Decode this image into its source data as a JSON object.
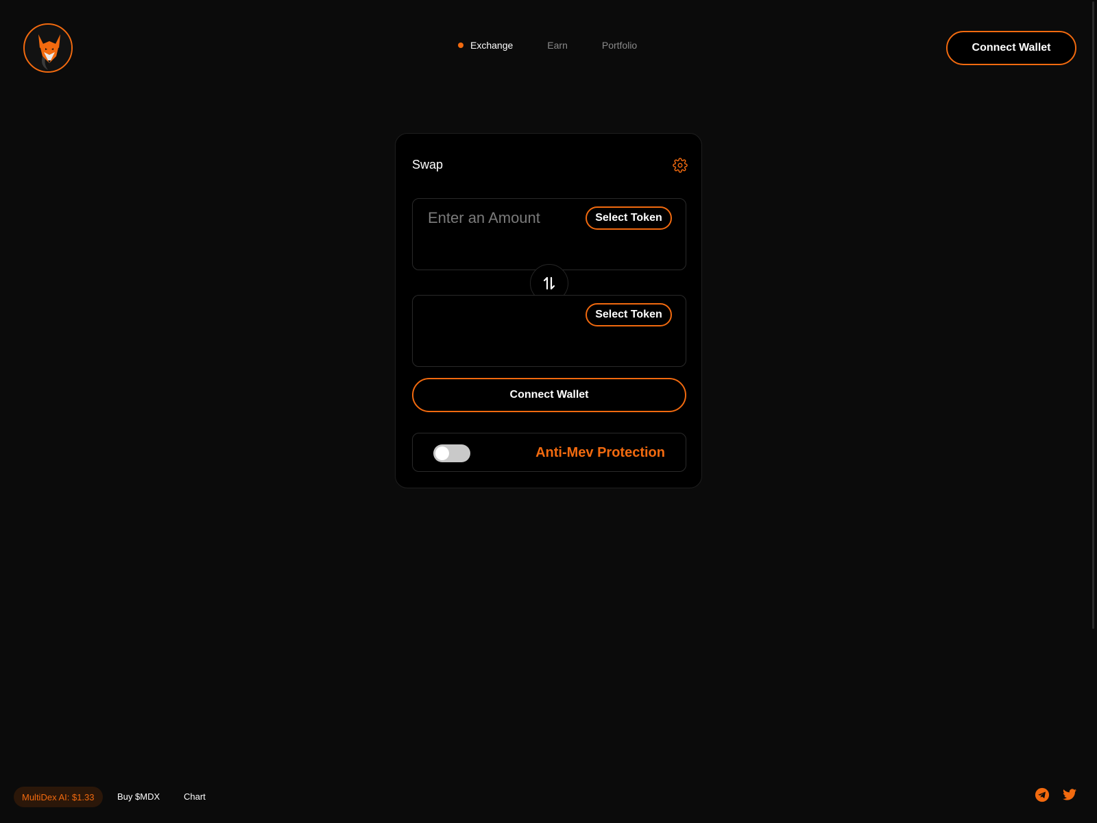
{
  "header": {
    "nav": [
      {
        "label": "Exchange",
        "active": true
      },
      {
        "label": "Earn",
        "active": false
      },
      {
        "label": "Portfolio",
        "active": false
      }
    ],
    "connect_label": "Connect Wallet"
  },
  "swap": {
    "title": "Swap",
    "from": {
      "amount_placeholder": "Enter an Amount",
      "select_label": "Select Token"
    },
    "to": {
      "select_label": "Select Token"
    },
    "connect_label": "Connect Wallet",
    "anti_mev": {
      "label": "Anti-Mev Protection",
      "enabled": false
    }
  },
  "footer": {
    "price_label": "MultiDex AI: $1.33",
    "buy_label": "Buy $MDX",
    "chart_label": "Chart"
  },
  "icons": {
    "logo": "fox-logo-icon",
    "settings": "gear-icon",
    "swap": "swap-arrows-icon",
    "telegram": "telegram-icon",
    "twitter": "twitter-icon"
  },
  "colors": {
    "accent": "#f26a0f",
    "background": "#0b0b0b",
    "card": "#000000"
  }
}
